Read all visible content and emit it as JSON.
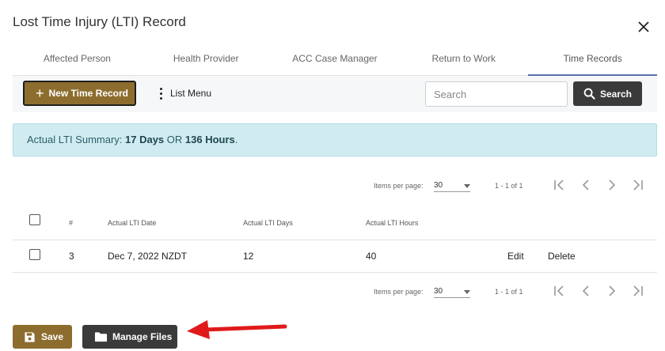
{
  "dialog": {
    "title": "Lost Time Injury (LTI) Record"
  },
  "tabs": [
    {
      "label": "Affected Person"
    },
    {
      "label": "Health Provider"
    },
    {
      "label": "ACC Case Manager"
    },
    {
      "label": "Return to Work"
    },
    {
      "label": "Time Records",
      "active": true
    }
  ],
  "toolbar": {
    "new_label": "New Time Record",
    "list_menu_label": "List Menu",
    "search_placeholder": "Search",
    "search_value": "",
    "search_button": "Search"
  },
  "summary": {
    "prefix": "Actual LTI Summary: ",
    "days": "17 Days",
    "joiner": " OR ",
    "hours": "136 Hours",
    "suffix": "."
  },
  "pagination": {
    "items_per_page_label": "Items per page:",
    "items_per_page": "30",
    "range": "1 - 1 of 1"
  },
  "table": {
    "columns": [
      "#",
      "Actual LTI Date",
      "Actual LTI Days",
      "Actual LTI Hours"
    ],
    "rows": [
      {
        "num": "3",
        "date": "Dec 7, 2022 NZDT",
        "days": "12",
        "hours": "40",
        "edit": "Edit",
        "delete": "Delete"
      }
    ]
  },
  "footer": {
    "save_label": "Save",
    "files_label": "Manage Files"
  },
  "colors": {
    "brand_gold": "#8d6d2e",
    "dark_button": "#3a3a3a",
    "info_bg": "#d0ecf0",
    "annotation_arrow": "#e01a1a"
  },
  "icons": [
    "close-icon",
    "plus-icon",
    "kebab-icon",
    "search-icon",
    "first-page-icon",
    "previous-page-icon",
    "next-page-icon",
    "last-page-icon",
    "save-icon",
    "folder-icon",
    "red-arrow-annotation"
  ]
}
